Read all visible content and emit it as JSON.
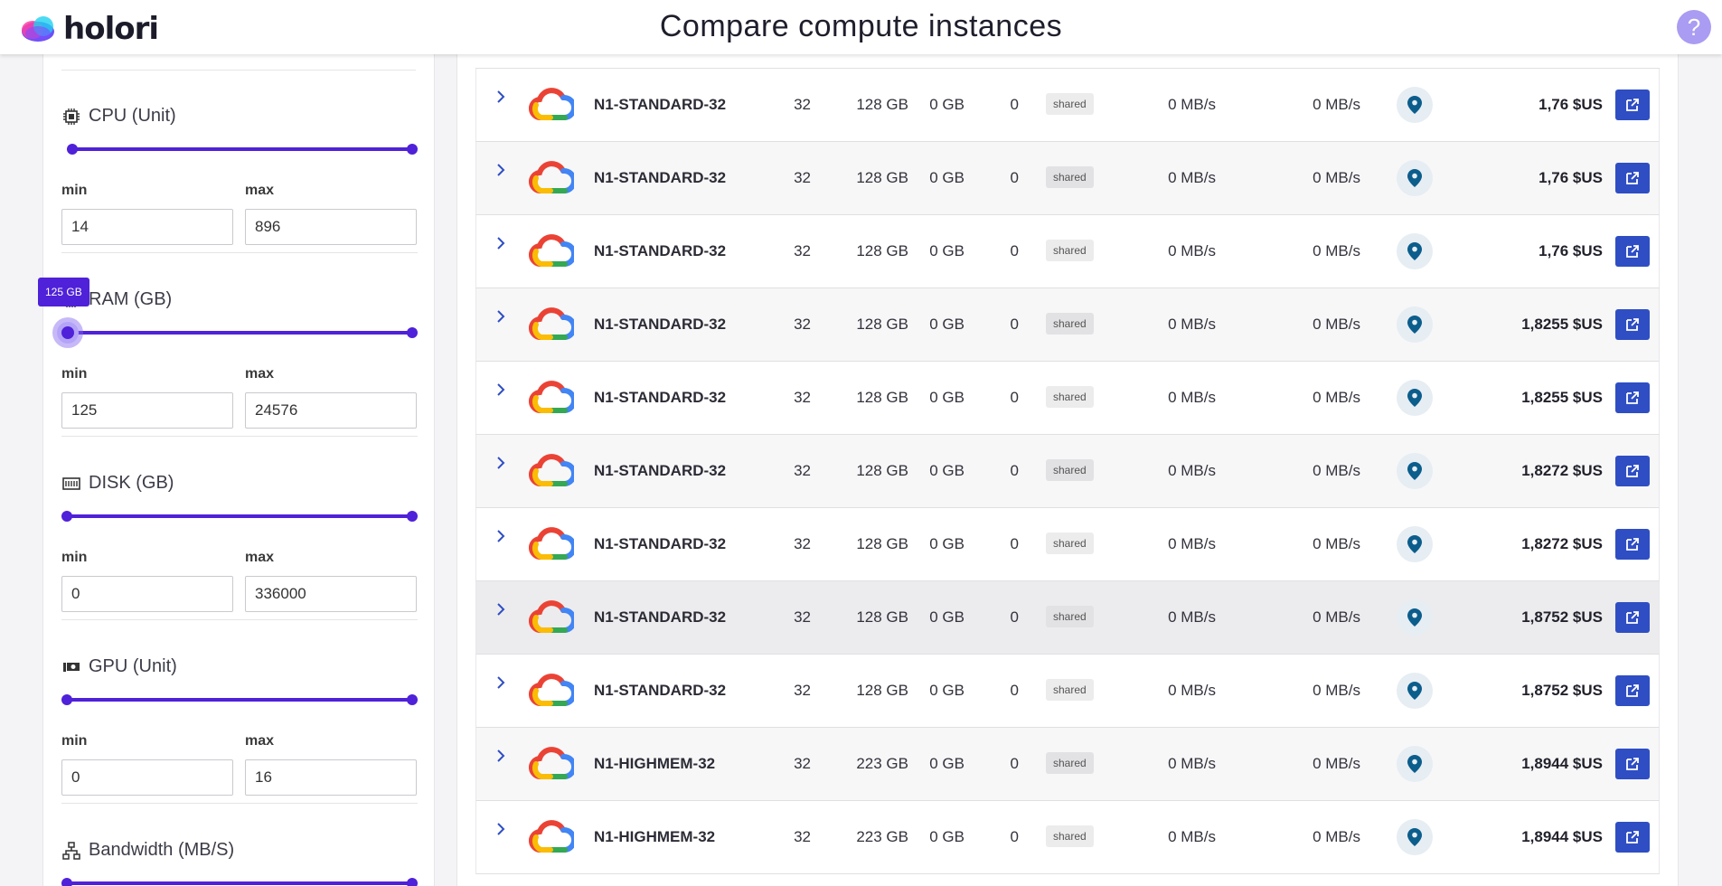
{
  "header": {
    "brand": "holori",
    "title": "Compare compute instances",
    "help": "?"
  },
  "filters": [
    {
      "id": "cpu",
      "title": "CPU (Unit)",
      "icon": "cpu-icon",
      "min_label": "min",
      "max_label": "max",
      "min": "14",
      "max": "896"
    },
    {
      "id": "ram",
      "title": "RAM (GB)",
      "icon": "memory-icon",
      "min_label": "min",
      "max_label": "max",
      "min": "125",
      "max": "24576",
      "tooltip": "125 GB"
    },
    {
      "id": "disk",
      "title": "DISK (GB)",
      "icon": "disk-icon",
      "min_label": "min",
      "max_label": "max",
      "min": "0",
      "max": "336000"
    },
    {
      "id": "gpu",
      "title": "GPU (Unit)",
      "icon": "gpu-icon",
      "min_label": "min",
      "max_label": "max",
      "min": "0",
      "max": "16"
    },
    {
      "id": "bandwidth",
      "title": "Bandwidth (MB/S)",
      "icon": "network-icon"
    }
  ],
  "colors": {
    "accent": "#4f21d9",
    "action": "#2f4ec4",
    "help": "#a99cf2"
  },
  "rows": [
    {
      "name": "N1-STANDARD-32",
      "vcpu": "32",
      "ram": "128 GB",
      "disk": "0 GB",
      "gpu": "0",
      "cpu_type": "shared",
      "net_in": "0 MB/s",
      "net_out": "0 MB/s",
      "price": "1,76 $US"
    },
    {
      "name": "N1-STANDARD-32",
      "vcpu": "32",
      "ram": "128 GB",
      "disk": "0 GB",
      "gpu": "0",
      "cpu_type": "shared",
      "net_in": "0 MB/s",
      "net_out": "0 MB/s",
      "price": "1,76 $US"
    },
    {
      "name": "N1-STANDARD-32",
      "vcpu": "32",
      "ram": "128 GB",
      "disk": "0 GB",
      "gpu": "0",
      "cpu_type": "shared",
      "net_in": "0 MB/s",
      "net_out": "0 MB/s",
      "price": "1,76 $US"
    },
    {
      "name": "N1-STANDARD-32",
      "vcpu": "32",
      "ram": "128 GB",
      "disk": "0 GB",
      "gpu": "0",
      "cpu_type": "shared",
      "net_in": "0 MB/s",
      "net_out": "0 MB/s",
      "price": "1,8255 $US"
    },
    {
      "name": "N1-STANDARD-32",
      "vcpu": "32",
      "ram": "128 GB",
      "disk": "0 GB",
      "gpu": "0",
      "cpu_type": "shared",
      "net_in": "0 MB/s",
      "net_out": "0 MB/s",
      "price": "1,8255 $US"
    },
    {
      "name": "N1-STANDARD-32",
      "vcpu": "32",
      "ram": "128 GB",
      "disk": "0 GB",
      "gpu": "0",
      "cpu_type": "shared",
      "net_in": "0 MB/s",
      "net_out": "0 MB/s",
      "price": "1,8272 $US"
    },
    {
      "name": "N1-STANDARD-32",
      "vcpu": "32",
      "ram": "128 GB",
      "disk": "0 GB",
      "gpu": "0",
      "cpu_type": "shared",
      "net_in": "0 MB/s",
      "net_out": "0 MB/s",
      "price": "1,8272 $US"
    },
    {
      "name": "N1-STANDARD-32",
      "vcpu": "32",
      "ram": "128 GB",
      "disk": "0 GB",
      "gpu": "0",
      "cpu_type": "shared",
      "net_in": "0 MB/s",
      "net_out": "0 MB/s",
      "price": "1,8752 $US"
    },
    {
      "name": "N1-STANDARD-32",
      "vcpu": "32",
      "ram": "128 GB",
      "disk": "0 GB",
      "gpu": "0",
      "cpu_type": "shared",
      "net_in": "0 MB/s",
      "net_out": "0 MB/s",
      "price": "1,8752 $US"
    },
    {
      "name": "N1-HIGHMEM-32",
      "vcpu": "32",
      "ram": "223 GB",
      "disk": "0 GB",
      "gpu": "0",
      "cpu_type": "shared",
      "net_in": "0 MB/s",
      "net_out": "0 MB/s",
      "price": "1,8944 $US"
    },
    {
      "name": "N1-HIGHMEM-32",
      "vcpu": "32",
      "ram": "223 GB",
      "disk": "0 GB",
      "gpu": "0",
      "cpu_type": "shared",
      "net_in": "0 MB/s",
      "net_out": "0 MB/s",
      "price": "1,8944 $US"
    }
  ]
}
